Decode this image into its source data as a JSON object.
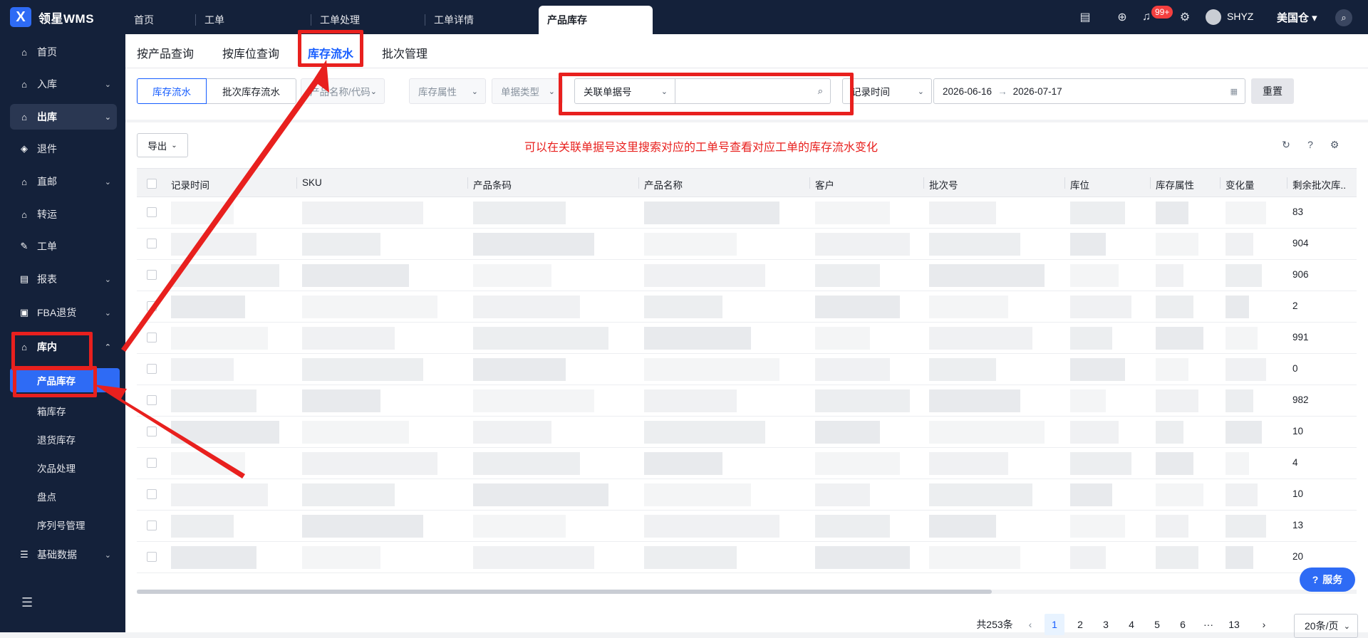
{
  "app": {
    "logo_letter": "X",
    "name": "领星WMS"
  },
  "top_tabs": [
    {
      "label": "首页"
    },
    {
      "label": "工单"
    },
    {
      "label": "工单处理"
    },
    {
      "label": "工单详情"
    },
    {
      "label": "产品库存"
    }
  ],
  "header": {
    "notification_badge": "99+",
    "user": "SHYZ",
    "warehouse": "美国仓"
  },
  "sidebar": {
    "items": [
      {
        "label": "首页"
      },
      {
        "label": "入库"
      },
      {
        "label": "出库"
      },
      {
        "label": "退件"
      },
      {
        "label": "直邮"
      },
      {
        "label": "转运"
      },
      {
        "label": "工单"
      },
      {
        "label": "报表"
      },
      {
        "label": "FBA退货"
      },
      {
        "label": "库内"
      },
      {
        "label": "基础数据"
      }
    ],
    "sub_items": [
      {
        "label": "产品库存"
      },
      {
        "label": "箱库存"
      },
      {
        "label": "退货库存"
      },
      {
        "label": "次品处理"
      },
      {
        "label": "盘点"
      },
      {
        "label": "序列号管理"
      }
    ]
  },
  "sub_tabs": [
    {
      "label": "按产品查询"
    },
    {
      "label": "按库位查询"
    },
    {
      "label": "库存流水"
    },
    {
      "label": "批次管理"
    }
  ],
  "filters": {
    "seg_left": "库存流水",
    "seg_right": "批次库存流水",
    "product_placeholder": "产品名称/代码",
    "attr_placeholder": "库存属性",
    "doc_type_placeholder": "单据类型",
    "related_doc": "关联单据号",
    "related_doc_input": "",
    "time_type": "记录时间",
    "date_start": "2026-06-16",
    "date_arrow": "→",
    "date_end": "2026-07-17",
    "reset": "重置"
  },
  "toolbar": {
    "export": "导出",
    "annotation": "可以在关联单据号这里搜索对应的工单号查看对应工单的库存流水变化"
  },
  "table": {
    "columns": [
      "记录时间",
      "SKU",
      "产品条码",
      "产品名称",
      "客户",
      "批次号",
      "库位",
      "库存属性",
      "变化量",
      "剩余批次库.."
    ],
    "remaining": [
      "83",
      "904",
      "906",
      "2",
      "991",
      "0",
      "982",
      "10",
      "4",
      "10",
      "13",
      "20"
    ]
  },
  "pagination": {
    "total": "共253条",
    "pages": [
      "1",
      "2",
      "3",
      "4",
      "5",
      "6",
      "···",
      "13"
    ],
    "page_size": "20条/页"
  },
  "service": "服务",
  "colors": {
    "brand": "#165dff",
    "sidebar_bg": "#14213a",
    "annotation_red": "#e8201e"
  }
}
